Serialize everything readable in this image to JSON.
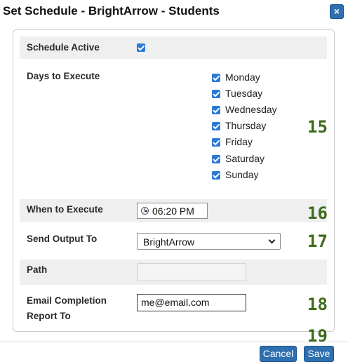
{
  "dialog": {
    "title": "Set Schedule - BrightArrow - Students",
    "close_icon": "close-icon",
    "close_glyph": "×"
  },
  "form": {
    "schedule_active": {
      "label": "Schedule Active",
      "checked": true
    },
    "days": {
      "label": "Days to Execute",
      "items": [
        {
          "label": "Monday",
          "checked": true
        },
        {
          "label": "Tuesday",
          "checked": true
        },
        {
          "label": "Wednesday",
          "checked": true
        },
        {
          "label": "Thursday",
          "checked": true
        },
        {
          "label": "Friday",
          "checked": true
        },
        {
          "label": "Saturday",
          "checked": true
        },
        {
          "label": "Sunday",
          "checked": true
        }
      ]
    },
    "when": {
      "label": "When to Execute",
      "value": "06:20 PM",
      "icon": "clock-icon"
    },
    "output": {
      "label": "Send Output To",
      "value": "BrightArrow"
    },
    "path": {
      "label": "Path",
      "value": ""
    },
    "email": {
      "label_line1": "Email Completion",
      "label_line2": "Report To",
      "value": "me@email.com"
    }
  },
  "annotations": [
    "15",
    "16",
    "17",
    "18",
    "19"
  ],
  "buttons": {
    "cancel": "Cancel",
    "save": "Save"
  },
  "colors": {
    "accent": "#2e6fb0",
    "checkbox": "#2a7ad6",
    "annotation": "#3d6b1a",
    "row_shade": "#efefef"
  }
}
